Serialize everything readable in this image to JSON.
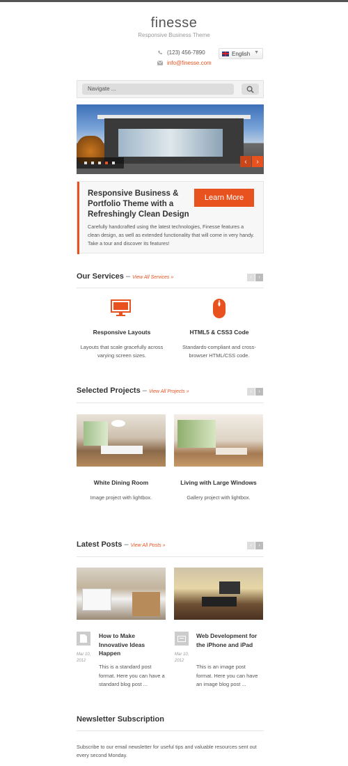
{
  "site": {
    "logo": "finesse",
    "tagline": "Responsive Business Theme"
  },
  "contact": {
    "phone": "(123) 456-7890",
    "email": "info@finesse.com",
    "language": "English"
  },
  "nav": {
    "placeholder": "Navigate ..."
  },
  "promo": {
    "title": "Responsive Business & Portfolio Theme with a Refreshingly Clean Design",
    "button": "Learn More",
    "text": "Carefully handcrafted using the latest technologies, Finesse features a clean design, as well as extended functionality that will come in very handy. Take a tour and discover its features!"
  },
  "services": {
    "heading": "Our Services",
    "link": "View All Services »",
    "items": [
      {
        "icon": "monitor-icon",
        "title": "Responsive Layouts",
        "text": "Layouts that scale gracefully across varying screen sizes."
      },
      {
        "icon": "mouse-icon",
        "title": "HTML5 & CSS3 Code",
        "text": "Standards-compliant and cross-browser HTML/CSS code."
      }
    ]
  },
  "projects": {
    "heading": "Selected Projects",
    "link": "View All Projects »",
    "items": [
      {
        "title": "White Dining Room",
        "text": "Image project with lightbox."
      },
      {
        "title": "Living with Large Windows",
        "text": "Gallery project with lightbox."
      }
    ]
  },
  "posts": {
    "heading": "Latest Posts",
    "link": "View All Posts »",
    "items": [
      {
        "icon": "document-icon",
        "date": "Mar 10, 2012",
        "title": "How to Make Innovative Ideas Happen",
        "text": "This is a standard post format. Here you can have a standard blog post ..."
      },
      {
        "icon": "image-icon",
        "date": "Mar 10, 2012",
        "title": "Web Development for the iPhone and iPad",
        "text": "This is an image post format. Here you can have an image blog post ..."
      }
    ]
  },
  "newsletter": {
    "heading": "Newsletter Subscription",
    "text": "Subscribe to our email newsletter for useful tips and valuable resources sent out every second Monday."
  },
  "colors": {
    "accent": "#e8521f",
    "text": "#444444"
  }
}
